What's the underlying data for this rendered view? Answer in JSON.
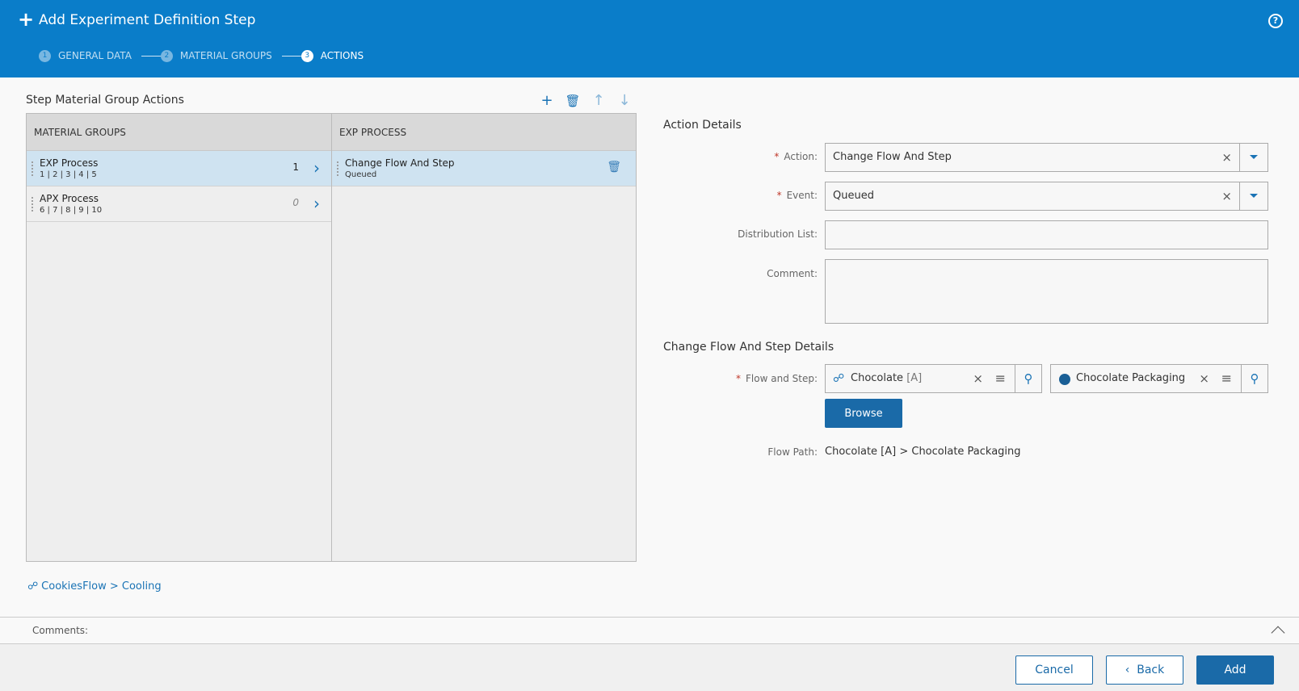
{
  "header": {
    "title": "Add Experiment Definition Step",
    "help_icon": "?",
    "steps": [
      {
        "num": "1",
        "label": "GENERAL DATA",
        "active": false
      },
      {
        "num": "2",
        "label": "MATERIAL GROUPS",
        "active": false
      },
      {
        "num": "3",
        "label": "ACTIONS",
        "active": true
      }
    ]
  },
  "left": {
    "title": "Step Material Group Actions",
    "toolbar": {
      "add_icon": "plus-icon",
      "delete_icon": "trash-icon",
      "up_icon": "arrow-up-icon",
      "down_icon": "arrow-down-icon"
    },
    "material_groups": {
      "header": "MATERIAL GROUPS",
      "rows": [
        {
          "name": "EXP Process",
          "sub": "1 | 2 | 3 | 4 | 5",
          "count": "1"
        },
        {
          "name": "APX Process",
          "sub": "6 | 7 | 8 | 9 | 10",
          "count": "0"
        }
      ]
    },
    "exp_process": {
      "header": "EXP PROCESS",
      "rows": [
        {
          "name": "Change Flow And Step",
          "sub": "Queued"
        }
      ]
    },
    "footer_link": "CookiesFlow > Cooling"
  },
  "right": {
    "action_details_title": "Action Details",
    "action": {
      "label": "Action:",
      "value": "Change Flow And Step"
    },
    "event": {
      "label": "Event:",
      "value": "Queued"
    },
    "distribution": {
      "label": "Distribution List:",
      "value": ""
    },
    "comment": {
      "label": "Comment:",
      "value": ""
    },
    "flow_details_title": "Change Flow And Step Details",
    "flow_step": {
      "label": "Flow and Step:",
      "flow_value": "Chocolate",
      "flow_revision": "[A]",
      "step_value": "Chocolate Packaging"
    },
    "browse_label": "Browse",
    "flow_path": {
      "label": "Flow Path:",
      "value": "Chocolate [A] > Chocolate Packaging"
    }
  },
  "comments_bar": {
    "label": "Comments:"
  },
  "buttons": {
    "cancel": "Cancel",
    "back": "Back",
    "add": "Add"
  },
  "colors": {
    "header": "#0a7dc9",
    "accent": "#1a6aa8",
    "selected_row": "#cfe3f1"
  }
}
